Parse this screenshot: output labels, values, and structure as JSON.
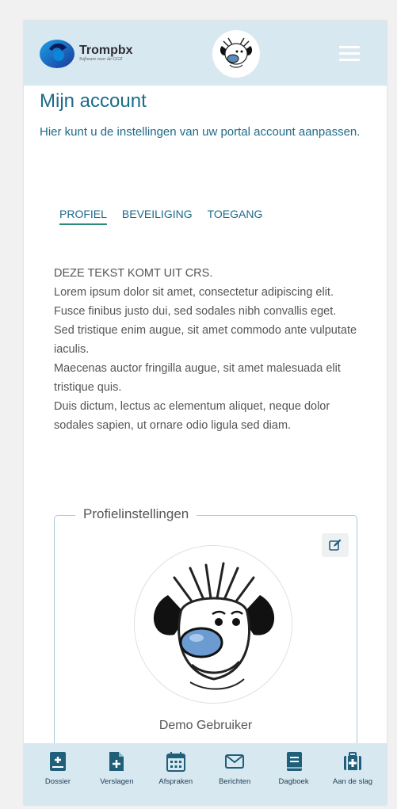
{
  "header": {
    "logo_name": "Trompbx",
    "logo_tagline": "Software voor de GGZ",
    "menu_icon": "hamburger-icon",
    "avatar": "dog-avatar"
  },
  "page": {
    "title": "Mijn account",
    "intro": "Hier kunt u de instellingen van uw portal account aanpassen."
  },
  "tabs": [
    {
      "label": "PROFIEL",
      "active": true
    },
    {
      "label": "BEVEILIGING",
      "active": false
    },
    {
      "label": "TOEGANG",
      "active": false
    }
  ],
  "crs_text": [
    "DEZE TEKST KOMT UIT CRS.",
    "Lorem ipsum dolor sit amet, consectetur adipiscing elit.",
    "Fusce finibus justo dui, sed sodales nibh convallis eget.",
    "Sed tristique enim augue, sit amet commodo ante vulputate iaculis.",
    "Maecenas auctor fringilla augue, sit amet malesuada elit tristique quis.",
    "Duis dictum, lectus ac elementum aliquet, neque dolor sodales sapien, ut ornare odio ligula sed diam."
  ],
  "profile": {
    "legend": "Profielinstellingen",
    "edit_icon": "edit-icon",
    "name": "Demo Gebruiker"
  },
  "bottom_nav": [
    {
      "label": "Dossier",
      "icon": "dossier-icon"
    },
    {
      "label": "Verslagen",
      "icon": "document-plus-icon"
    },
    {
      "label": "Afspraken",
      "icon": "calendar-icon"
    },
    {
      "label": "Berichten",
      "icon": "envelope-icon"
    },
    {
      "label": "Dagboek",
      "icon": "book-icon"
    },
    {
      "label": "Aan de slag",
      "icon": "medkit-icon"
    }
  ],
  "colors": {
    "header_bg": "#d8e8f0",
    "primary": "#1d6a8a",
    "tab_underline": "#2c8a7c",
    "icon_blue": "#1f5f7a"
  }
}
